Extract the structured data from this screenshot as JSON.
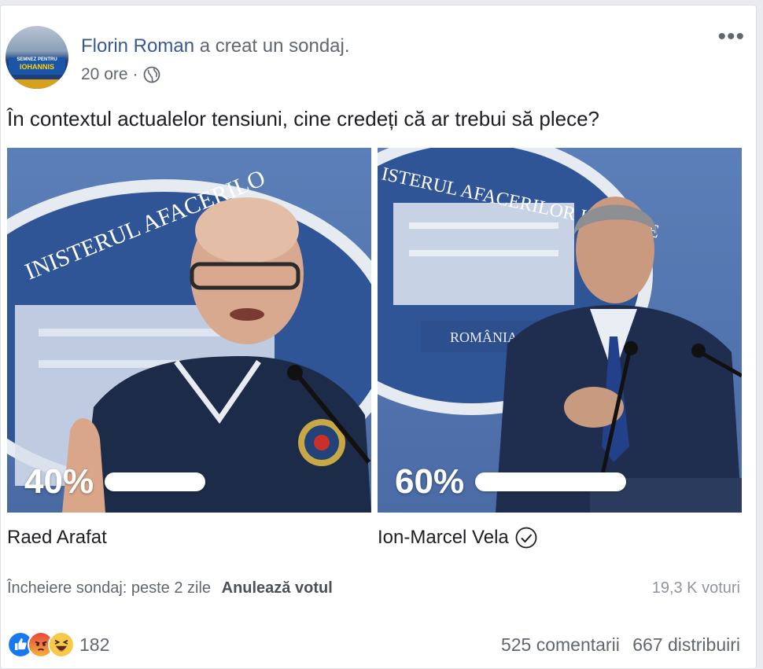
{
  "post": {
    "author": "Florin Roman",
    "action": "a creat un sondaj.",
    "time": "20 ore",
    "separator": "·",
    "avatar_text_small": "SEMNEZ PENTRU",
    "avatar_text_big": "IOHANNIS",
    "more_icon": "•••",
    "question": "În contextul actualelor tensiuni, cine credeți că ar trebui să plece?"
  },
  "poll": {
    "options": [
      {
        "name": "Raed Arafat",
        "percent_label": "40%",
        "percent": 40,
        "selected": false
      },
      {
        "name": "Ion-Marcel Vela",
        "percent_label": "60%",
        "percent": 60,
        "selected": true
      }
    ],
    "photo_text": {
      "left_arc": "INISTERUL AFACERILO",
      "right_arc": "ISTERUL AFACERILOR INTERNE",
      "right_plate": "ROMÂNIA"
    },
    "ends": "Încheiere sondaj: peste 2 zile",
    "unvote": "Anulează votul",
    "votes": "19,3 K voturi"
  },
  "footer": {
    "reactions": [
      "like-icon",
      "angry-icon",
      "haha-icon"
    ],
    "reaction_count": "182",
    "comments": "525 comentarii",
    "shares": "667 distribuiri"
  },
  "colors": {
    "author": "#385898",
    "muted": "#606770",
    "bar": "#ffffff"
  }
}
